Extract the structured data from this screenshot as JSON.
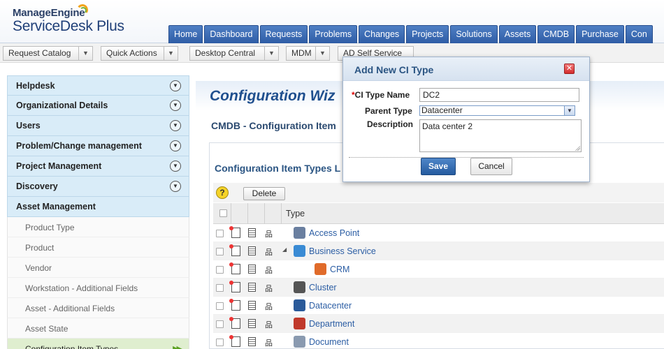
{
  "brand": {
    "line1": "ManageEngine",
    "line2": "ServiceDesk Plus",
    "accent": "#f2a31a"
  },
  "nav": [
    "Home",
    "Dashboard",
    "Requests",
    "Problems",
    "Changes",
    "Projects",
    "Solutions",
    "Assets",
    "CMDB",
    "Purchase",
    "Con"
  ],
  "toolbar": {
    "request_catalog": "Request Catalog",
    "quick_actions": "Quick Actions",
    "desktop_central": "Desktop Central",
    "mdm": "MDM",
    "ad_self_service": "AD Self Service"
  },
  "sidebar": {
    "sections": [
      "Helpdesk",
      "Organizational Details",
      "Users",
      "Problem/Change management",
      "Project Management",
      "Discovery",
      "Asset Management"
    ],
    "sub_items": [
      "Product Type",
      "Product",
      "Vendor",
      "Workstation - Additional Fields",
      "Asset - Additional Fields",
      "Asset State",
      "Configuration Item Types"
    ],
    "active_sub": "Configuration Item Types"
  },
  "main": {
    "title": "Configuration Wiz",
    "breadcrumb": "CMDB -  Configuration Item",
    "panel_title": "Configuration Item Types L",
    "delete_label": "Delete",
    "column_type": "Type",
    "rows": [
      {
        "name": "Access Point",
        "expandable": false,
        "child": false,
        "icon": "access-point-icon",
        "color": "#6a7fa0"
      },
      {
        "name": "Business Service",
        "expandable": true,
        "child": false,
        "icon": "business-service-icon",
        "color": "#3a8bd4"
      },
      {
        "name": "CRM",
        "expandable": false,
        "child": true,
        "icon": "crm-icon",
        "color": "#e06b2a"
      },
      {
        "name": "Cluster",
        "expandable": false,
        "child": false,
        "icon": "cluster-icon",
        "color": "#555555"
      },
      {
        "name": "Datacenter",
        "expandable": false,
        "child": false,
        "icon": "datacenter-icon",
        "color": "#2a5a9a"
      },
      {
        "name": "Department",
        "expandable": false,
        "child": false,
        "icon": "department-icon",
        "color": "#c0392b"
      },
      {
        "name": "Document",
        "expandable": false,
        "child": false,
        "icon": "document-icon",
        "color": "#8a9ab0"
      }
    ]
  },
  "dialog": {
    "title": "Add New CI Type",
    "required_marker": "*",
    "ci_type_name_label": "CI Type Name",
    "ci_type_name_value": "DC2",
    "parent_type_label": "Parent Type",
    "parent_type_value": "Datacenter",
    "description_label": "Description",
    "description_value": "Data center 2",
    "save_label": "Save",
    "cancel_label": "Cancel"
  }
}
